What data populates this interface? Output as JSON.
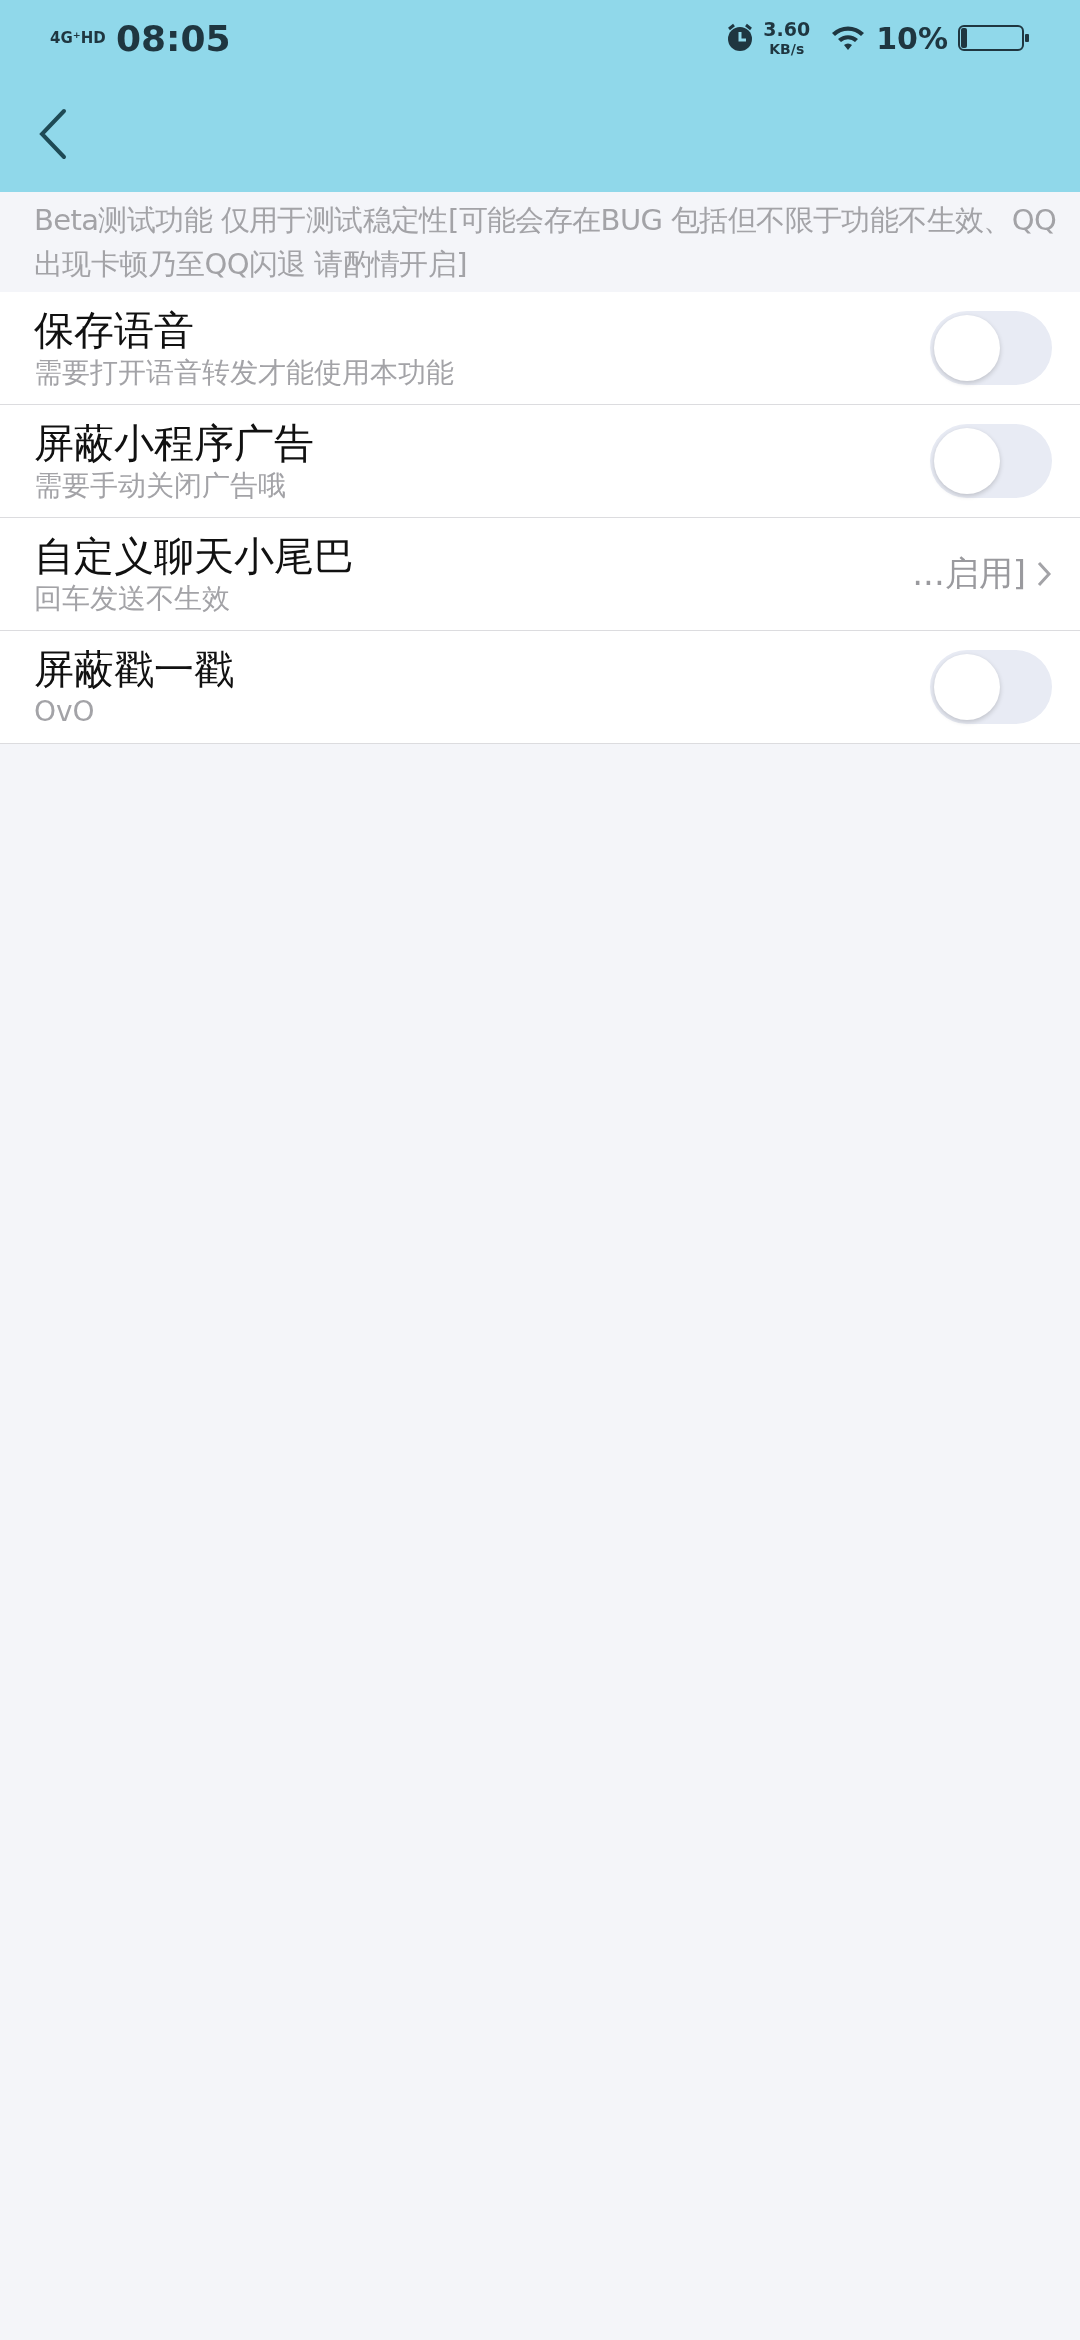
{
  "status_bar": {
    "network": "4G⁺HD",
    "time": "08:05",
    "speed": "3.60",
    "speed_unit": "KB/s",
    "battery": "10%"
  },
  "notice": "Beta测试功能 仅用于测试稳定性[可能会存在BUG 包括但不限于功能不生效、QQ出现卡顿乃至QQ闪退 请酌情开启]",
  "settings": [
    {
      "kind": "toggle",
      "title": "保存语音",
      "subtitle": "需要打开语音转发才能使用本功能",
      "on": false
    },
    {
      "kind": "toggle",
      "title": "屏蔽小程序广告",
      "subtitle": "需要手动关闭广告哦",
      "on": false
    },
    {
      "kind": "link",
      "title": "自定义聊天小尾巴",
      "subtitle": "回车发送不生效",
      "value": "...启用]"
    },
    {
      "kind": "toggle",
      "title": "屏蔽戳一戳",
      "subtitle": "OvO",
      "on": false
    }
  ]
}
